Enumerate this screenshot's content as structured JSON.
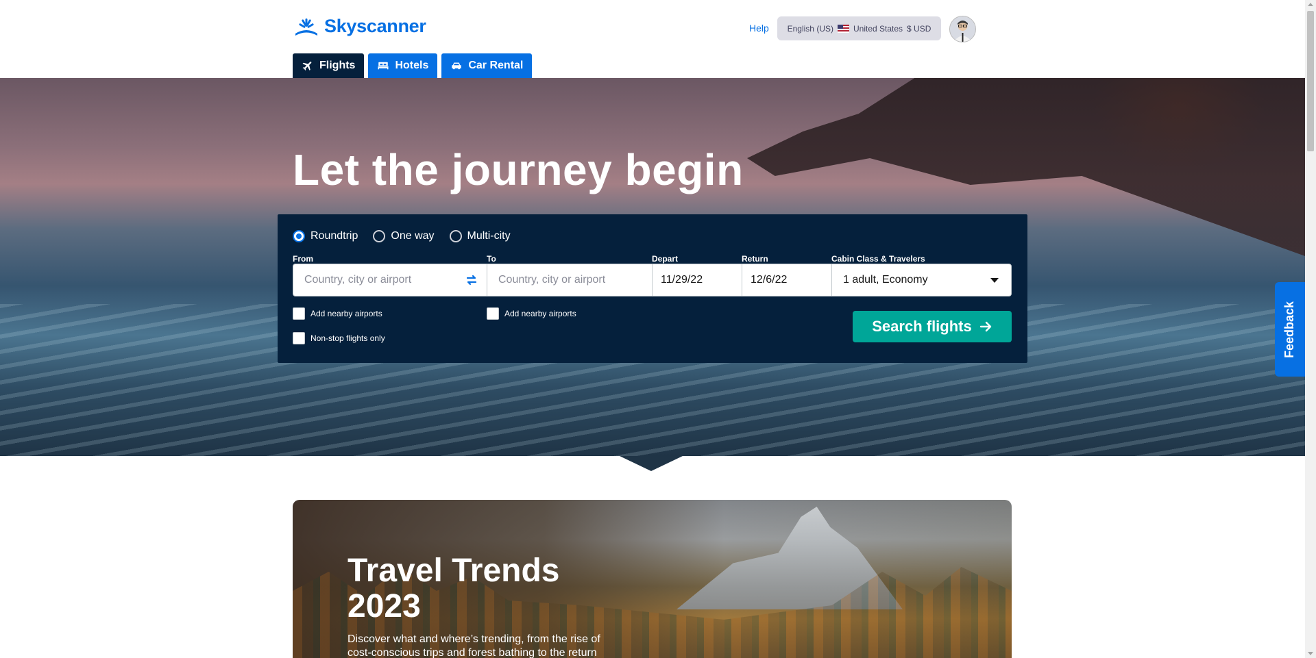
{
  "header": {
    "logo_text": "Skyscanner",
    "help_label": "Help",
    "locale": {
      "language": "English (US)",
      "country": "United States",
      "currency": "$ USD"
    }
  },
  "tabs": [
    {
      "label": "Flights",
      "icon": "plane-icon",
      "active": true
    },
    {
      "label": "Hotels",
      "icon": "bed-icon",
      "active": false
    },
    {
      "label": "Car Rental",
      "icon": "car-icon",
      "active": false
    }
  ],
  "hero": {
    "headline": "Let the journey begin"
  },
  "search": {
    "trip_types": [
      {
        "label": "Roundtrip",
        "checked": true
      },
      {
        "label": "One way",
        "checked": false
      },
      {
        "label": "Multi-city",
        "checked": false
      }
    ],
    "from": {
      "label": "From",
      "placeholder": "Country, city or airport"
    },
    "to": {
      "label": "To",
      "placeholder": "Country, city or airport"
    },
    "depart": {
      "label": "Depart",
      "value": "11/29/22"
    },
    "return": {
      "label": "Return",
      "value": "12/6/22"
    },
    "cabin": {
      "label": "Cabin Class & Travelers",
      "value": "1 adult, Economy"
    },
    "nearby_from_label": "Add nearby airports",
    "nearby_to_label": "Add nearby airports",
    "nonstop_label": "Non-stop flights only",
    "search_button_label": "Search flights"
  },
  "feedback_label": "Feedback",
  "trends": {
    "title": "Travel Trends 2023",
    "description": "Discover what and where’s trending, from the rise of cost-conscious trips and forest bathing to the return"
  },
  "colors": {
    "brand_blue": "#0770e3",
    "navy": "#05203c",
    "search_button": "#00a698"
  }
}
